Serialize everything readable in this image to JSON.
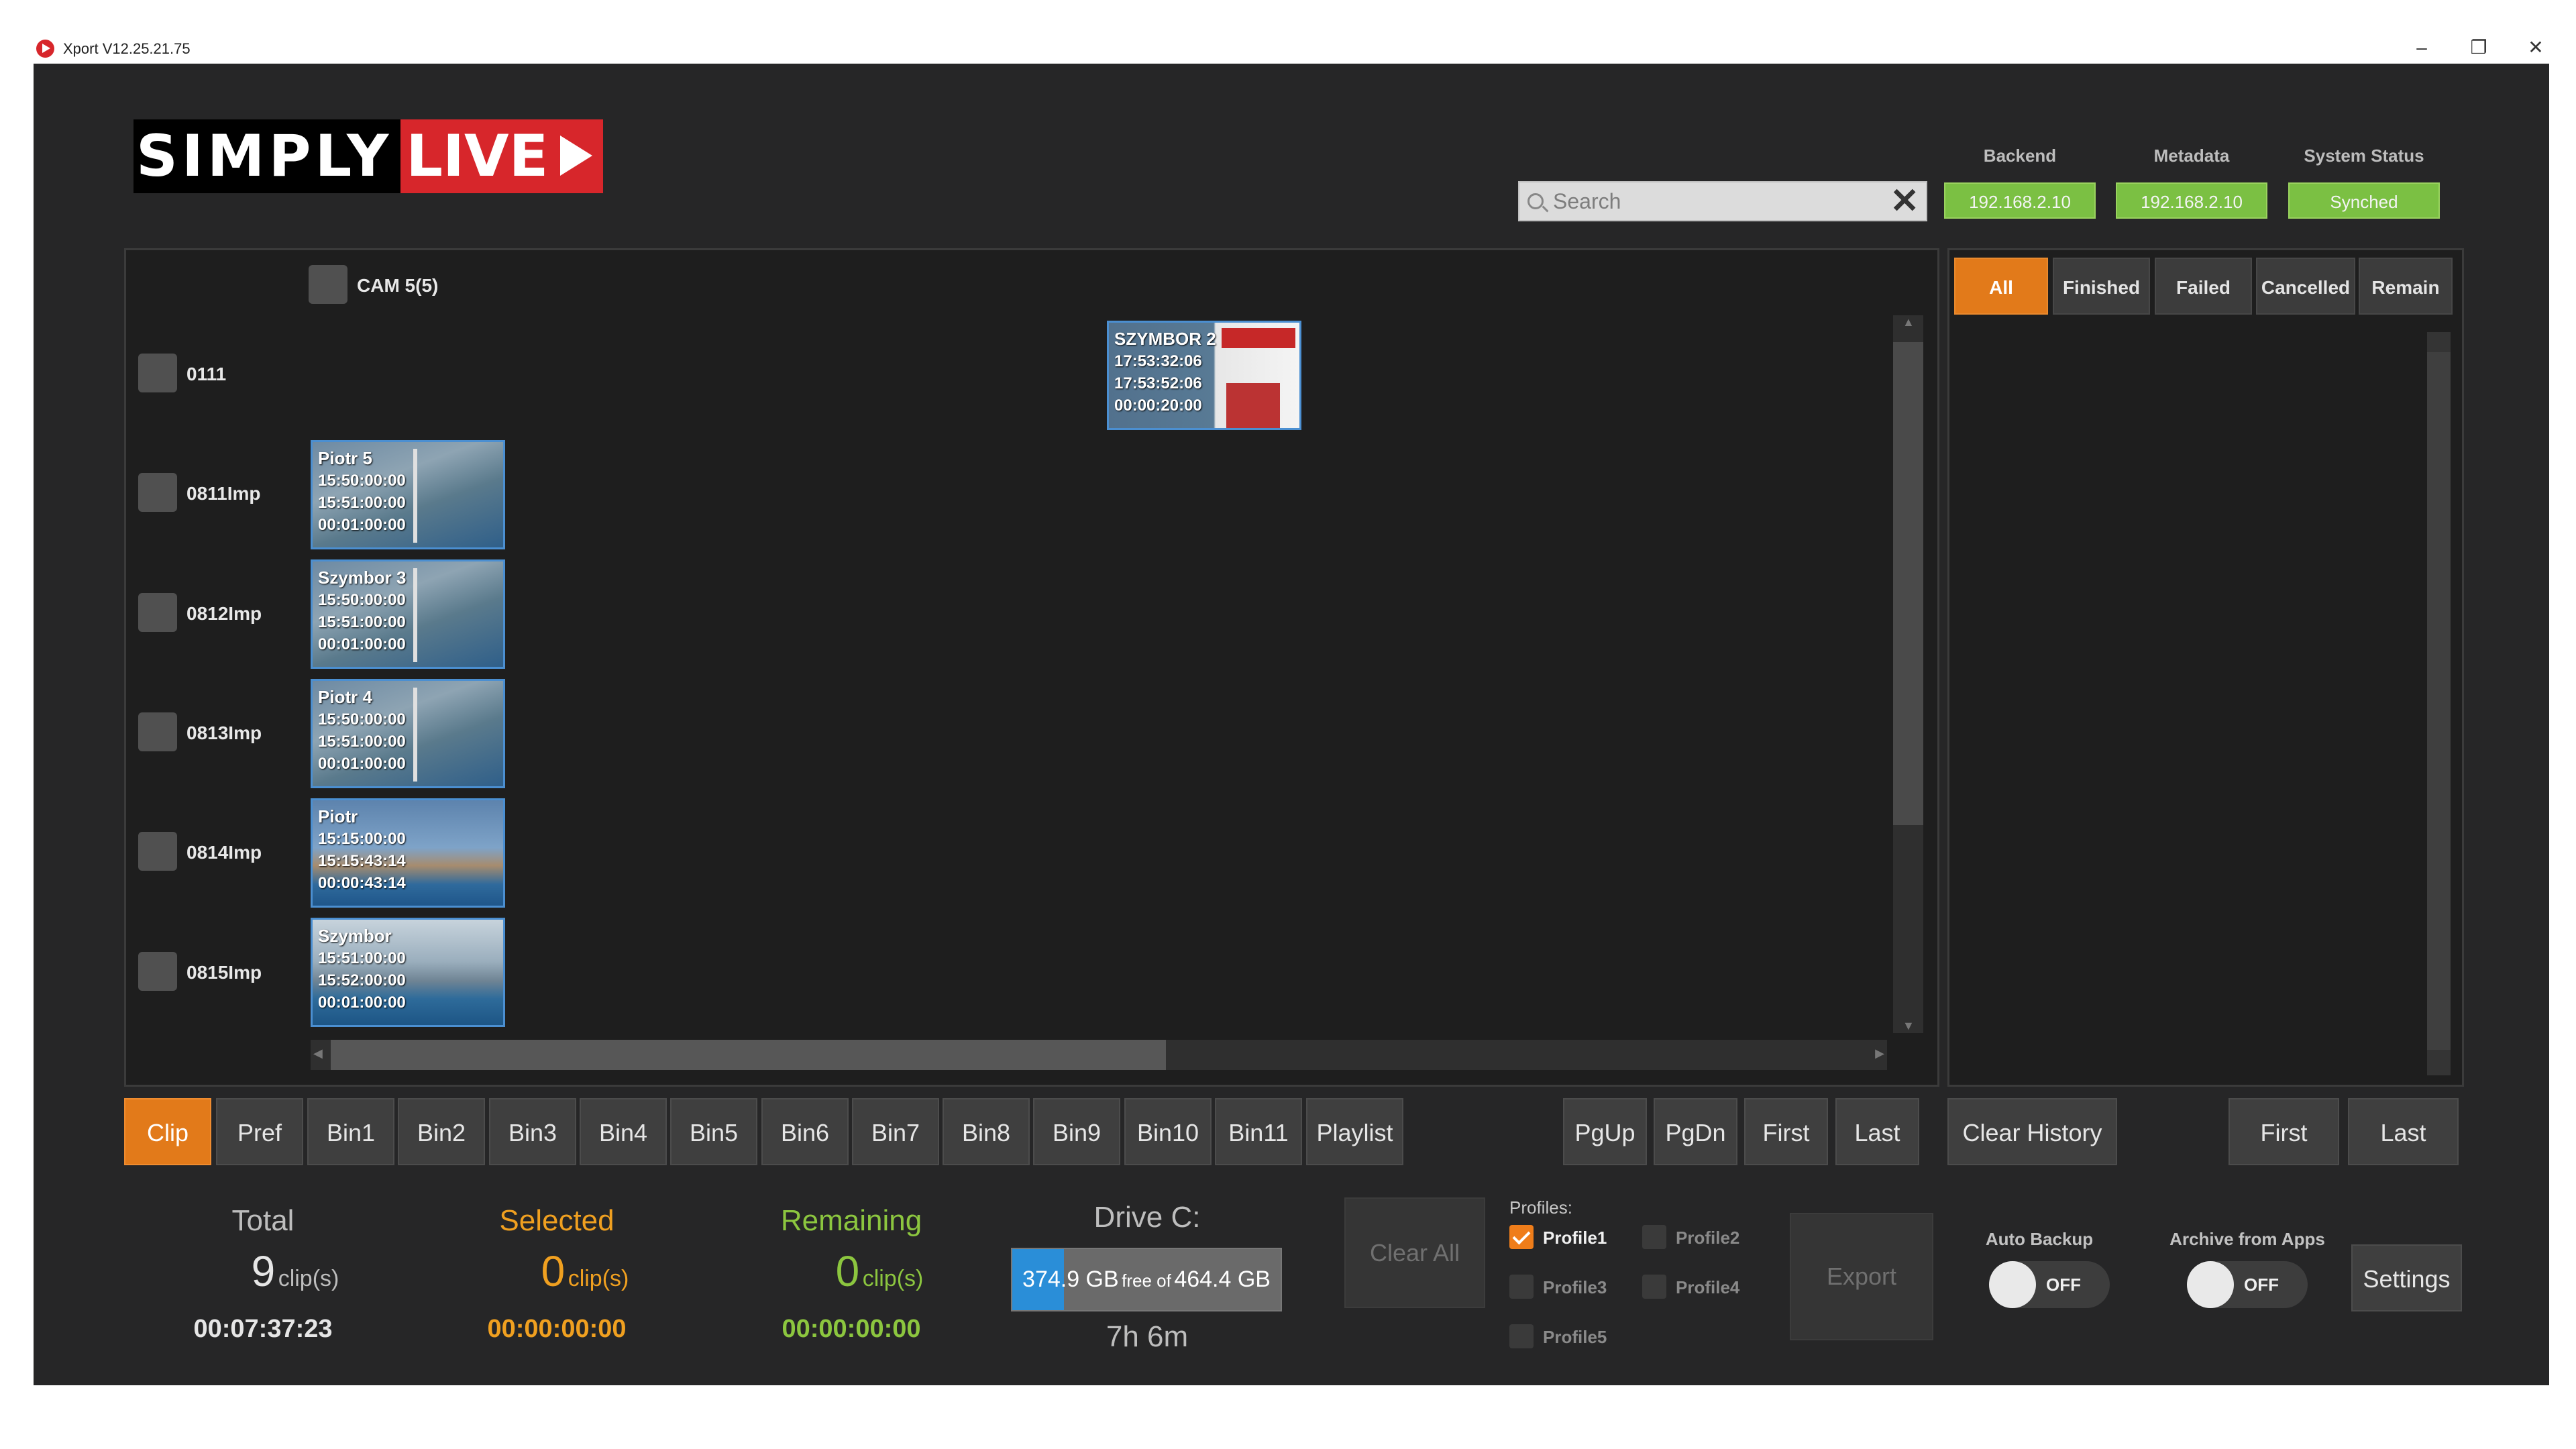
{
  "window": {
    "title": "Xport V12.25.21.75",
    "minimize": "–",
    "restore": "❐",
    "close": "✕"
  },
  "logo": {
    "part1": "SIMPLY",
    "part2": "LIVE"
  },
  "search": {
    "placeholder": "Search",
    "value": "",
    "clear_icon": "✕"
  },
  "status": {
    "backend_label": "Backend",
    "backend_value": "192.168.2.10",
    "metadata_label": "Metadata",
    "metadata_value": "192.168.2.10",
    "system_label": "System Status",
    "system_value": "Synched",
    "ok_color": "#7bc043"
  },
  "grid": {
    "camera_header": "CAM 5(5)",
    "rows": [
      {
        "label": "0111",
        "clip": {
          "name": "SZYMBOR 2",
          "tc_in": "17:53:32:06",
          "tc_out": "17:53:52:06",
          "duration": "00:00:20:00"
        }
      },
      {
        "label": "0811Imp",
        "clip": {
          "name": "Piotr 5",
          "tc_in": "15:50:00:00",
          "tc_out": "15:51:00:00",
          "duration": "00:01:00:00"
        }
      },
      {
        "label": "0812Imp",
        "clip": {
          "name": "Szymbor 3",
          "tc_in": "15:50:00:00",
          "tc_out": "15:51:00:00",
          "duration": "00:01:00:00"
        }
      },
      {
        "label": "0813Imp",
        "clip": {
          "name": "Piotr 4",
          "tc_in": "15:50:00:00",
          "tc_out": "15:51:00:00",
          "duration": "00:01:00:00"
        }
      },
      {
        "label": "0814Imp",
        "clip": {
          "name": "Piotr",
          "tc_in": "15:15:00:00",
          "tc_out": "15:15:43:14",
          "duration": "00:00:43:14"
        }
      },
      {
        "label": "0815Imp",
        "clip": {
          "name": "Szymbor",
          "tc_in": "15:51:00:00",
          "tc_out": "15:52:00:00",
          "duration": "00:01:00:00"
        }
      }
    ]
  },
  "filters": [
    "All",
    "Finished",
    "Failed",
    "Cancelled",
    "Remain"
  ],
  "bins": [
    "Clip",
    "Pref",
    "Bin1",
    "Bin2",
    "Bin3",
    "Bin4",
    "Bin5",
    "Bin6",
    "Bin7",
    "Bin8",
    "Bin9",
    "Bin10",
    "Bin11",
    "Playlist"
  ],
  "nav": {
    "pgup": "PgUp",
    "pgdn": "PgDn",
    "first": "First",
    "last": "Last"
  },
  "history": {
    "clear": "Clear History",
    "first": "First",
    "last": "Last"
  },
  "stats": {
    "unit": "clip(s)",
    "total_label": "Total",
    "total_count": "9",
    "total_time": "00:07:37:23",
    "selected_label": "Selected",
    "selected_count": "0",
    "selected_time": "00:00:00:00",
    "remaining_label": "Remaining",
    "remaining_count": "0",
    "remaining_time": "00:00:00:00",
    "total_color": "#bdbdbd",
    "selected_color": "#f0a020",
    "remaining_color": "#8cc63f"
  },
  "drive": {
    "label": "Drive C:",
    "free": "374.9 GB",
    "free_of": "free of",
    "total": "464.4 GB",
    "used_fraction": 0.193,
    "time_left": "7h 6m"
  },
  "actions": {
    "clear_all": "Clear All",
    "export": "Export",
    "settings": "Settings"
  },
  "profiles": {
    "label": "Profiles:",
    "items": [
      {
        "name": "Profile1",
        "checked": true
      },
      {
        "name": "Profile2",
        "checked": false
      },
      {
        "name": "Profile3",
        "checked": false
      },
      {
        "name": "Profile4",
        "checked": false
      },
      {
        "name": "Profile5",
        "checked": false
      }
    ]
  },
  "toggles": {
    "auto_backup_label": "Auto Backup",
    "auto_backup_state": "OFF",
    "archive_label": "Archive from Apps",
    "archive_state": "OFF"
  }
}
